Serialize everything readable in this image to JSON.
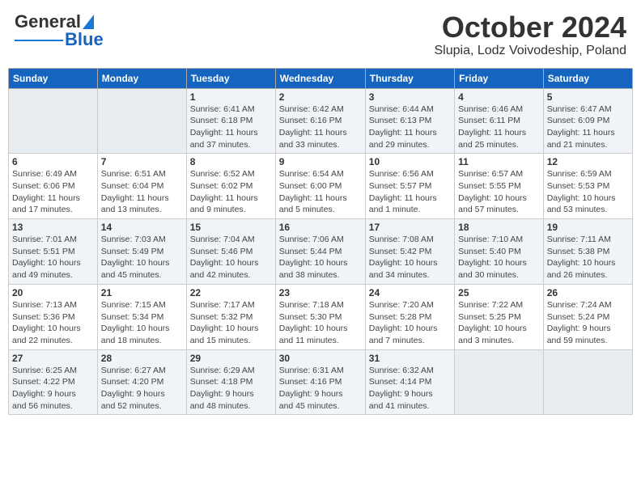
{
  "header": {
    "logo_general": "General",
    "logo_blue": "Blue",
    "month": "October 2024",
    "location": "Slupia, Lodz Voivodeship, Poland"
  },
  "weekdays": [
    "Sunday",
    "Monday",
    "Tuesday",
    "Wednesday",
    "Thursday",
    "Friday",
    "Saturday"
  ],
  "weeks": [
    [
      {
        "day": "",
        "info": ""
      },
      {
        "day": "",
        "info": ""
      },
      {
        "day": "1",
        "info": "Sunrise: 6:41 AM\nSunset: 6:18 PM\nDaylight: 11 hours\nand 37 minutes."
      },
      {
        "day": "2",
        "info": "Sunrise: 6:42 AM\nSunset: 6:16 PM\nDaylight: 11 hours\nand 33 minutes."
      },
      {
        "day": "3",
        "info": "Sunrise: 6:44 AM\nSunset: 6:13 PM\nDaylight: 11 hours\nand 29 minutes."
      },
      {
        "day": "4",
        "info": "Sunrise: 6:46 AM\nSunset: 6:11 PM\nDaylight: 11 hours\nand 25 minutes."
      },
      {
        "day": "5",
        "info": "Sunrise: 6:47 AM\nSunset: 6:09 PM\nDaylight: 11 hours\nand 21 minutes."
      }
    ],
    [
      {
        "day": "6",
        "info": "Sunrise: 6:49 AM\nSunset: 6:06 PM\nDaylight: 11 hours\nand 17 minutes."
      },
      {
        "day": "7",
        "info": "Sunrise: 6:51 AM\nSunset: 6:04 PM\nDaylight: 11 hours\nand 13 minutes."
      },
      {
        "day": "8",
        "info": "Sunrise: 6:52 AM\nSunset: 6:02 PM\nDaylight: 11 hours\nand 9 minutes."
      },
      {
        "day": "9",
        "info": "Sunrise: 6:54 AM\nSunset: 6:00 PM\nDaylight: 11 hours\nand 5 minutes."
      },
      {
        "day": "10",
        "info": "Sunrise: 6:56 AM\nSunset: 5:57 PM\nDaylight: 11 hours\nand 1 minute."
      },
      {
        "day": "11",
        "info": "Sunrise: 6:57 AM\nSunset: 5:55 PM\nDaylight: 10 hours\nand 57 minutes."
      },
      {
        "day": "12",
        "info": "Sunrise: 6:59 AM\nSunset: 5:53 PM\nDaylight: 10 hours\nand 53 minutes."
      }
    ],
    [
      {
        "day": "13",
        "info": "Sunrise: 7:01 AM\nSunset: 5:51 PM\nDaylight: 10 hours\nand 49 minutes."
      },
      {
        "day": "14",
        "info": "Sunrise: 7:03 AM\nSunset: 5:49 PM\nDaylight: 10 hours\nand 45 minutes."
      },
      {
        "day": "15",
        "info": "Sunrise: 7:04 AM\nSunset: 5:46 PM\nDaylight: 10 hours\nand 42 minutes."
      },
      {
        "day": "16",
        "info": "Sunrise: 7:06 AM\nSunset: 5:44 PM\nDaylight: 10 hours\nand 38 minutes."
      },
      {
        "day": "17",
        "info": "Sunrise: 7:08 AM\nSunset: 5:42 PM\nDaylight: 10 hours\nand 34 minutes."
      },
      {
        "day": "18",
        "info": "Sunrise: 7:10 AM\nSunset: 5:40 PM\nDaylight: 10 hours\nand 30 minutes."
      },
      {
        "day": "19",
        "info": "Sunrise: 7:11 AM\nSunset: 5:38 PM\nDaylight: 10 hours\nand 26 minutes."
      }
    ],
    [
      {
        "day": "20",
        "info": "Sunrise: 7:13 AM\nSunset: 5:36 PM\nDaylight: 10 hours\nand 22 minutes."
      },
      {
        "day": "21",
        "info": "Sunrise: 7:15 AM\nSunset: 5:34 PM\nDaylight: 10 hours\nand 18 minutes."
      },
      {
        "day": "22",
        "info": "Sunrise: 7:17 AM\nSunset: 5:32 PM\nDaylight: 10 hours\nand 15 minutes."
      },
      {
        "day": "23",
        "info": "Sunrise: 7:18 AM\nSunset: 5:30 PM\nDaylight: 10 hours\nand 11 minutes."
      },
      {
        "day": "24",
        "info": "Sunrise: 7:20 AM\nSunset: 5:28 PM\nDaylight: 10 hours\nand 7 minutes."
      },
      {
        "day": "25",
        "info": "Sunrise: 7:22 AM\nSunset: 5:25 PM\nDaylight: 10 hours\nand 3 minutes."
      },
      {
        "day": "26",
        "info": "Sunrise: 7:24 AM\nSunset: 5:24 PM\nDaylight: 9 hours\nand 59 minutes."
      }
    ],
    [
      {
        "day": "27",
        "info": "Sunrise: 6:25 AM\nSunset: 4:22 PM\nDaylight: 9 hours\nand 56 minutes."
      },
      {
        "day": "28",
        "info": "Sunrise: 6:27 AM\nSunset: 4:20 PM\nDaylight: 9 hours\nand 52 minutes."
      },
      {
        "day": "29",
        "info": "Sunrise: 6:29 AM\nSunset: 4:18 PM\nDaylight: 9 hours\nand 48 minutes."
      },
      {
        "day": "30",
        "info": "Sunrise: 6:31 AM\nSunset: 4:16 PM\nDaylight: 9 hours\nand 45 minutes."
      },
      {
        "day": "31",
        "info": "Sunrise: 6:32 AM\nSunset: 4:14 PM\nDaylight: 9 hours\nand 41 minutes."
      },
      {
        "day": "",
        "info": ""
      },
      {
        "day": "",
        "info": ""
      }
    ]
  ]
}
